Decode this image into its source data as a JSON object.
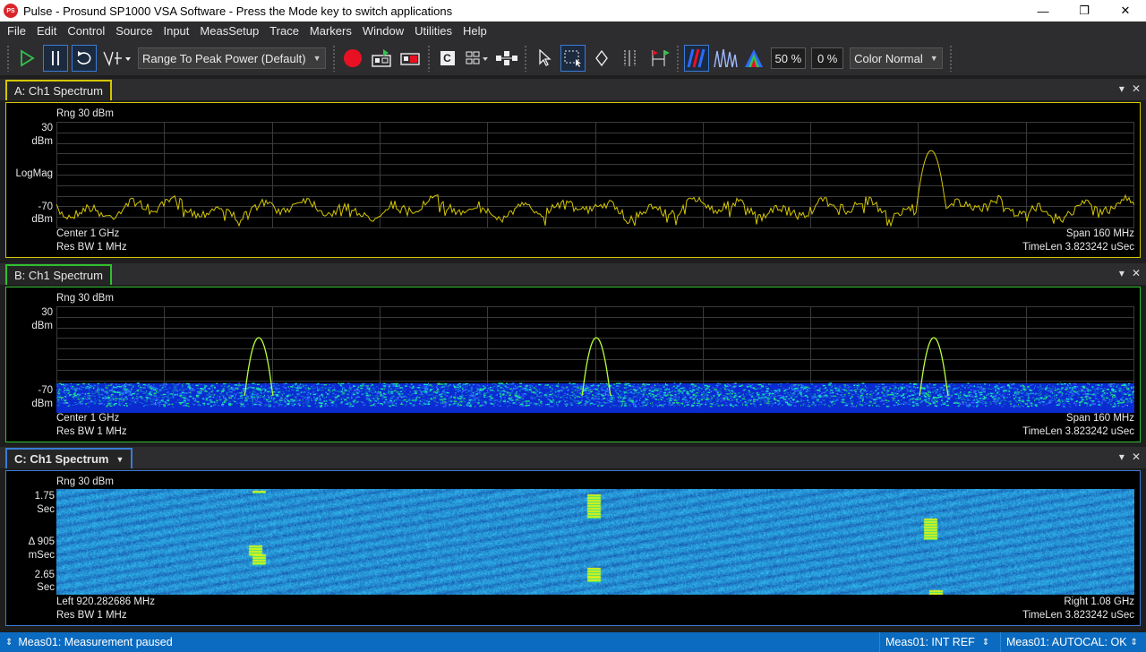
{
  "window": {
    "title": "Pulse - Prosund SP1000 VSA Software - Press the Mode key to switch applications",
    "app_icon_text": "PS",
    "minimize": "—",
    "maximize": "❐",
    "close": "✕"
  },
  "menu": [
    "File",
    "Edit",
    "Control",
    "Source",
    "Input",
    "MeasSetup",
    "Trace",
    "Markers",
    "Window",
    "Utilities",
    "Help"
  ],
  "toolbar": {
    "range_select": "Range To Peak Power (Default)",
    "zoom_percent": "50 %",
    "offset_percent": "0 %",
    "color_select": "Color Normal",
    "c_label": "C"
  },
  "panels": {
    "a": {
      "tab": "A: Ch1 Spectrum",
      "range": "Rng 30 dBm",
      "y_top_value": "30",
      "y_top_unit": "dBm",
      "y_mid": "LogMag",
      "y_bot_value": "-70",
      "y_bot_unit": "dBm",
      "bl1": "Center 1 GHz",
      "bl2": "Res BW 1 MHz",
      "br1": "Span 160 MHz",
      "br2": "TimeLen 3.823242 uSec",
      "accent": "#d4c600"
    },
    "b": {
      "tab": "B: Ch1 Spectrum",
      "range": "Rng 30 dBm",
      "y_top_value": "30",
      "y_top_unit": "dBm",
      "y_bot_value": "-70",
      "y_bot_unit": "dBm",
      "bl1": "Center 1 GHz",
      "bl2": "Res BW 1 MHz",
      "br1": "Span 160 MHz",
      "br2": "TimeLen 3.823242 uSec",
      "accent": "#2fc02f"
    },
    "c": {
      "tab": "C: Ch1 Spectrum",
      "range": "Rng 30 dBm",
      "y_top_value": "1.75",
      "y_top_unit": "Sec",
      "y_mid_value": "Δ 905",
      "y_mid_unit": "mSec",
      "y_bot_value": "2.65",
      "y_bot_unit": "Sec",
      "bl1": "Left 920.282686 MHz",
      "bl2": "Res BW 1 MHz",
      "br1": "Right 1.08 GHz",
      "br2": "TimeLen 3.823242 uSec",
      "accent": "#3a7bd5"
    }
  },
  "status": {
    "left": "Meas01:  Measurement paused",
    "ref": "Meas01:   INT REF",
    "cal": "Meas01: AUTOCAL: OK"
  }
}
